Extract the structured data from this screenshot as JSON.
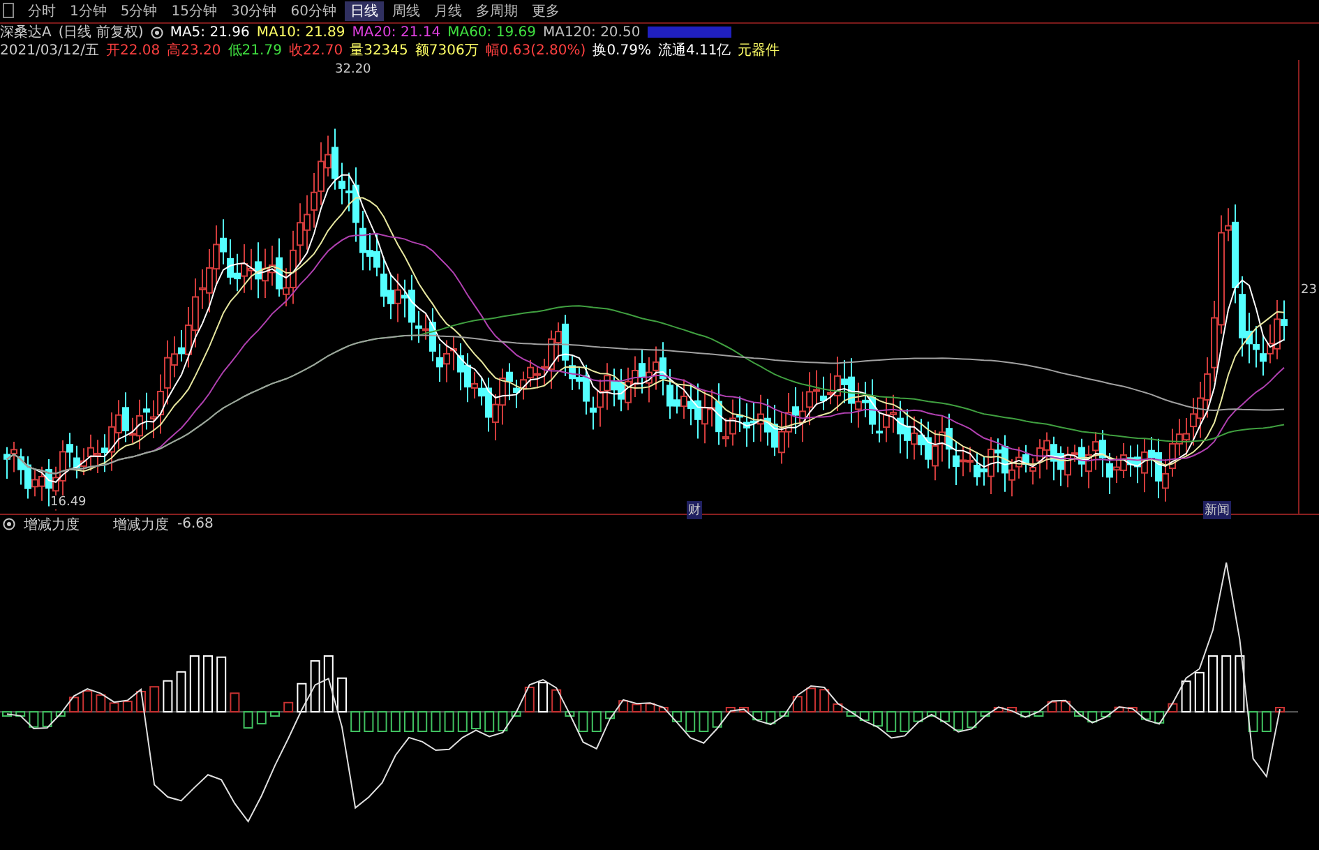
{
  "tabs": [
    {
      "label": "分时",
      "selected": false
    },
    {
      "label": "1分钟",
      "selected": false
    },
    {
      "label": "5分钟",
      "selected": false
    },
    {
      "label": "15分钟",
      "selected": false
    },
    {
      "label": "30分钟",
      "selected": false
    },
    {
      "label": "60分钟",
      "selected": false
    },
    {
      "label": "日线",
      "selected": true
    },
    {
      "label": "周线",
      "selected": false
    },
    {
      "label": "月线",
      "selected": false
    },
    {
      "label": "多周期",
      "selected": false
    },
    {
      "label": "更多",
      "selected": false
    }
  ],
  "header": {
    "title": "深桑达A",
    "mode": "(日线 前复权)",
    "ma": [
      {
        "label": "MA5: 21.96",
        "color": "#ffffff"
      },
      {
        "label": "MA10: 21.89",
        "color": "#ffff66"
      },
      {
        "label": "MA20: 21.14",
        "color": "#e040e0"
      },
      {
        "label": "MA60: 19.69",
        "color": "#40e040"
      },
      {
        "label": "MA120: 20.50",
        "color": "#c0c0c0"
      }
    ]
  },
  "quote": {
    "date": "2021/03/12/五",
    "items": [
      {
        "label": "开22.08",
        "color": "#ff4040"
      },
      {
        "label": "高23.20",
        "color": "#ff4040"
      },
      {
        "label": "低21.79",
        "color": "#40e040"
      },
      {
        "label": "收22.70",
        "color": "#ff4040"
      },
      {
        "label": "量32345",
        "color": "#ffff66"
      },
      {
        "label": "额7306万",
        "color": "#ffff66"
      },
      {
        "label": "幅0.63(2.80%)",
        "color": "#ff4040"
      },
      {
        "label": "换0.79%",
        "color": "#ffffff"
      },
      {
        "label": "流通4.11亿",
        "color": "#ffffff"
      },
      {
        "label": "元器件",
        "color": "#ffff66"
      }
    ]
  },
  "price_labels": {
    "high": "32.20",
    "low": "16.49"
  },
  "axis_label": "23",
  "markers": [
    "财",
    "新闻"
  ],
  "indicator": {
    "name": "增减力度",
    "value_label": "增减力度",
    "value": "-6.68"
  }
}
